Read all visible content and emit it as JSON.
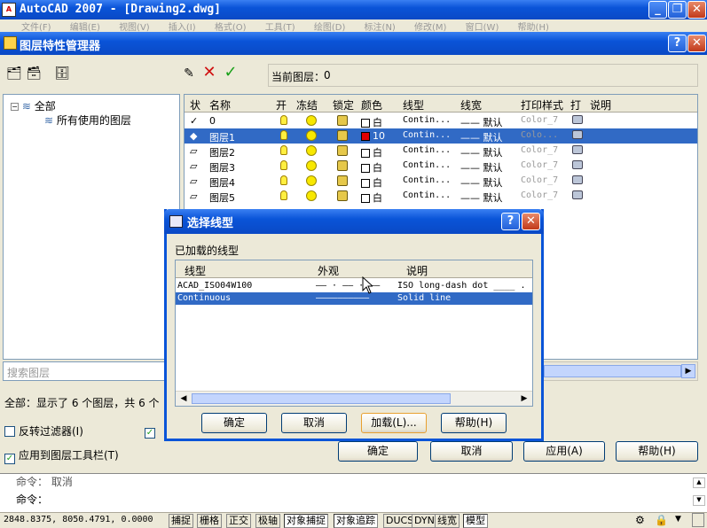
{
  "app": {
    "title": "AutoCAD 2007 - [Drawing2.dwg]",
    "logo": "A",
    "menu": [
      "文件(F)",
      "编辑(E)",
      "视图(V)",
      "插入(I)",
      "格式(O)",
      "工具(T)",
      "绘图(D)",
      "标注(N)",
      "修改(M)",
      "窗口(W)",
      "帮助(H)"
    ]
  },
  "layer_manager": {
    "title": "图层特性管理器",
    "current_layer_label": "当前图层：",
    "current_layer": "0",
    "tree": {
      "root": "全部",
      "child": "所有使用的图层"
    },
    "search_placeholder": "搜索图层",
    "columns": [
      "状",
      "名称",
      "开",
      "冻结",
      "锁定",
      "颜色",
      "线型",
      "线宽",
      "打印样式",
      "打",
      "说明"
    ],
    "rows": [
      {
        "status": "✓",
        "name": "0",
        "color_hex": "#ffffff",
        "color_name": "白",
        "linetype": "Contin...",
        "lineweight": "—— 默认",
        "plot_style": "Color_7",
        "selected": false
      },
      {
        "status": "◆",
        "name": "图层1",
        "color_hex": "#e00000",
        "color_name": "10",
        "linetype": "Contin...",
        "lineweight": "—— 默认",
        "plot_style": "Colo...",
        "selected": true
      },
      {
        "status": "▱",
        "name": "图层2",
        "color_hex": "#ffffff",
        "color_name": "白",
        "linetype": "Contin...",
        "lineweight": "—— 默认",
        "plot_style": "Color_7",
        "selected": false
      },
      {
        "status": "▱",
        "name": "图层3",
        "color_hex": "#ffffff",
        "color_name": "白",
        "linetype": "Contin...",
        "lineweight": "—— 默认",
        "plot_style": "Color_7",
        "selected": false
      },
      {
        "status": "▱",
        "name": "图层4",
        "color_hex": "#ffffff",
        "color_name": "白",
        "linetype": "Contin...",
        "lineweight": "—— 默认",
        "plot_style": "Color_7",
        "selected": false
      },
      {
        "status": "▱",
        "name": "图层5",
        "color_hex": "#ffffff",
        "color_name": "白",
        "linetype": "Contin...",
        "lineweight": "—— 默认",
        "plot_style": "Color_7",
        "selected": false
      }
    ],
    "summary": "全部：显示了 6 个图层，共 6 个",
    "invert_filter": "反转过滤器(I)",
    "apply_toolbar": "应用到图层工具栏(T)",
    "buttons": {
      "ok": "确定",
      "cancel": "取消",
      "apply": "应用(A)",
      "help": "帮助(H)"
    }
  },
  "dialog": {
    "title": "选择线型",
    "loaded_label": "已加载的线型",
    "columns": [
      "线型",
      "外观",
      "说明"
    ],
    "rows": [
      {
        "name": "ACAD_ISO04W100",
        "appearance": "—— · —— · ——",
        "desc": "ISO long-dash dot ____ .",
        "selected": false
      },
      {
        "name": "Continuous",
        "appearance": "——————————",
        "desc": "Solid line",
        "selected": true
      }
    ],
    "buttons": {
      "ok": "确定",
      "cancel": "取消",
      "load": "加载(L)...",
      "help": "帮助(H)"
    }
  },
  "command": {
    "line1": "命令： 取消",
    "line2": "命令："
  },
  "status": {
    "coords": "2848.8375, 8050.4791, 0.0000",
    "toggles": [
      "捕捉",
      "栅格",
      "正交",
      "极轴",
      "对象捕捉",
      "对象追踪",
      "DUCS",
      "DYN",
      "线宽",
      "模型"
    ]
  }
}
